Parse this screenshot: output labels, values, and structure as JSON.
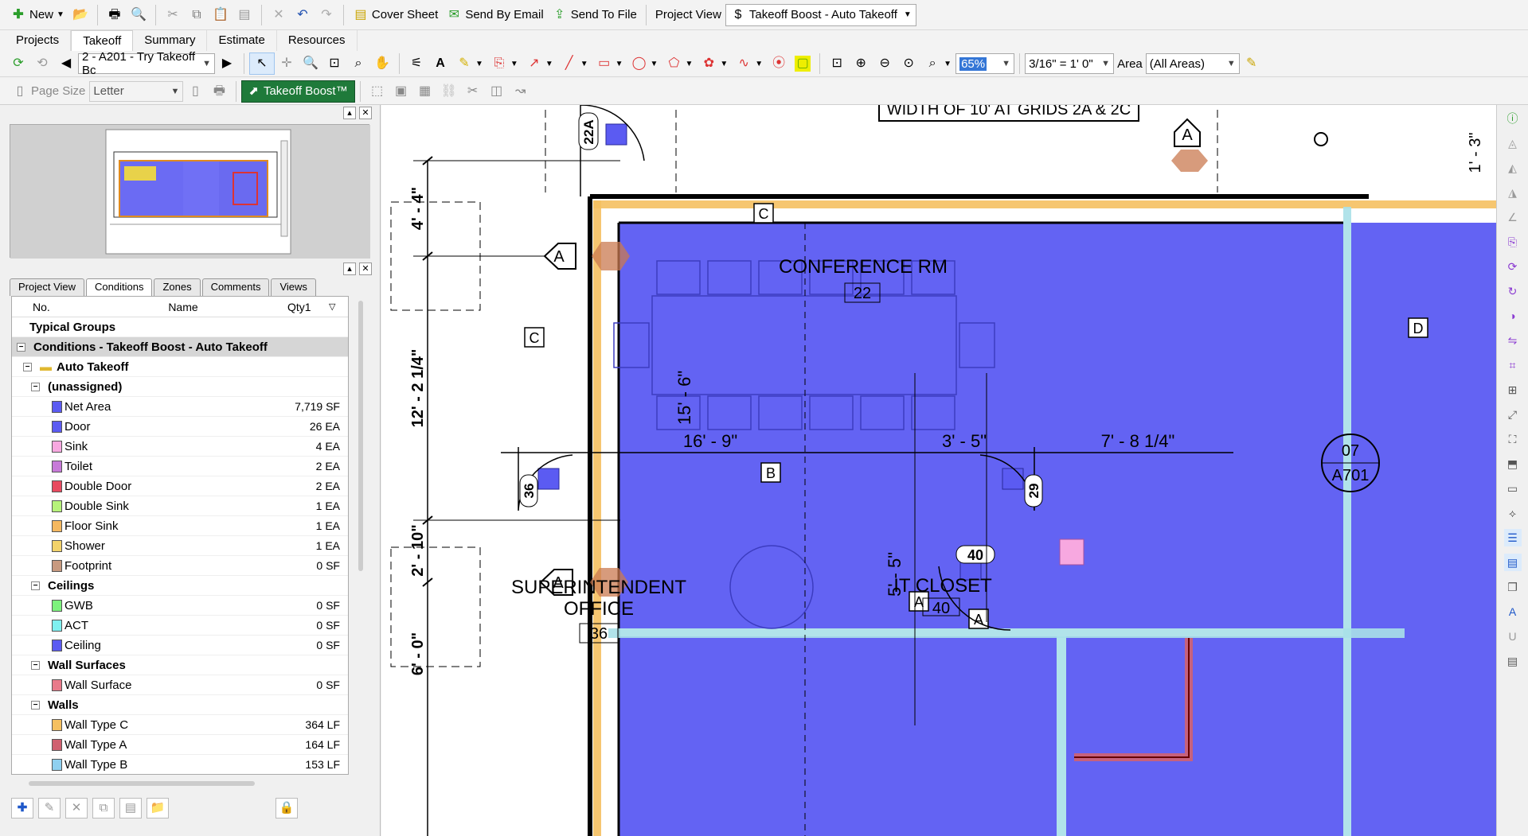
{
  "toolbar1": {
    "new": "New",
    "cover_sheet": "Cover Sheet",
    "send_email": "Send By Email",
    "send_file": "Send To File",
    "project_view": "Project View",
    "takeoff_boost_tab": "Takeoff Boost - Auto Takeoff"
  },
  "menus": [
    "Projects",
    "Takeoff",
    "Summary",
    "Estimate",
    "Resources"
  ],
  "toolbar3": {
    "page": "2 - A201 - Try Takeoff Bc",
    "zoom": "65%",
    "scale": "3/16\" = 1' 0\"",
    "area_label": "Area",
    "area_value": "(All Areas)"
  },
  "toolbar4": {
    "page_size_label": "Page Size",
    "page_size_value": "Letter",
    "takeoff_boost": "Takeoff Boost™"
  },
  "tabs": [
    "Project View",
    "Conditions",
    "Zones",
    "Comments",
    "Views"
  ],
  "grid": {
    "col_no": "No.",
    "col_name": "Name",
    "col_qty": "Qty1"
  },
  "rows": [
    {
      "kind": "plain",
      "name": "Typical Groups",
      "indent": 0
    },
    {
      "kind": "hl",
      "name": "Conditions - Takeoff Boost - Auto Takeoff",
      "indent": 0
    },
    {
      "kind": "folder",
      "name": "Auto Takeoff",
      "indent": 1
    },
    {
      "kind": "group",
      "name": "(unassigned)",
      "indent": 2
    },
    {
      "kind": "item",
      "name": "Net Area",
      "qty": "7,719 SF",
      "color": "#5b5bf2"
    },
    {
      "kind": "item",
      "name": "Door",
      "qty": "26 EA",
      "color": "#5b5bf2"
    },
    {
      "kind": "item",
      "name": "Sink",
      "qty": "4 EA",
      "color": "#f7a8e0"
    },
    {
      "kind": "item",
      "name": "Toilet",
      "qty": "2 EA",
      "color": "#c77ad8"
    },
    {
      "kind": "item",
      "name": "Double Door",
      "qty": "2 EA",
      "color": "#e84a5f"
    },
    {
      "kind": "item",
      "name": "Double Sink",
      "qty": "1 EA",
      "color": "#b6f27a"
    },
    {
      "kind": "item",
      "name": "Floor Sink",
      "qty": "1 EA",
      "color": "#f5b860"
    },
    {
      "kind": "item",
      "name": "Shower",
      "qty": "1 EA",
      "color": "#f2d26a"
    },
    {
      "kind": "item",
      "name": "Footprint",
      "qty": "0 SF",
      "color": "#c89a80"
    },
    {
      "kind": "group",
      "name": "Ceilings",
      "indent": 2
    },
    {
      "kind": "item",
      "name": "GWB",
      "qty": "0 SF",
      "color": "#7df27d"
    },
    {
      "kind": "item",
      "name": "ACT",
      "qty": "0 SF",
      "color": "#7ff0f0"
    },
    {
      "kind": "item",
      "name": "Ceiling",
      "qty": "0 SF",
      "color": "#5b5bf2"
    },
    {
      "kind": "group",
      "name": "Wall Surfaces",
      "indent": 2
    },
    {
      "kind": "item",
      "name": "Wall Surface",
      "qty": "0 SF",
      "color": "#e87a8a"
    },
    {
      "kind": "group",
      "name": "Walls",
      "indent": 2
    },
    {
      "kind": "item",
      "name": "Wall Type C",
      "qty": "364 LF",
      "color": "#f5c060"
    },
    {
      "kind": "item",
      "name": "Wall Type A",
      "qty": "164 LF",
      "color": "#d06070"
    },
    {
      "kind": "item",
      "name": "Wall Type B",
      "qty": "153 LF",
      "color": "#8fd0f0"
    }
  ],
  "drawing": {
    "top_note": "WIDTH OF 10' AT GRIDS 2A & 2C",
    "conf_room": "CONFERENCE RM",
    "conf_num": "22",
    "superintendent": "SUPERINTENDENT",
    "office": "OFFICE",
    "sup_num": "36",
    "it_closet": "IT CLOSET",
    "it_num": "40",
    "dim_16_9": "16' - 9\"",
    "dim_3_5": "3' - 5\"",
    "dim_7_8": "7' - 8 1/4\"",
    "dim_15_6": "15' - 6\"",
    "dim_4_4": "4' - 4\"",
    "dim_12_2": "12' - 2 1/4\"",
    "dim_2_10": "2' - 10\"",
    "dim_6_0": "6' - 0\"",
    "dim_5_5": "5' - 5\"",
    "dim_1_3": "1' - 3\"",
    "tag_22a": "22A",
    "tag_36": "36",
    "tag_29": "29",
    "tag_40": "40",
    "sec_a": "A",
    "sec_b": "B",
    "sec_c": "C",
    "sec_d": "D",
    "detail_num": "07",
    "detail_sheet": "A701"
  }
}
